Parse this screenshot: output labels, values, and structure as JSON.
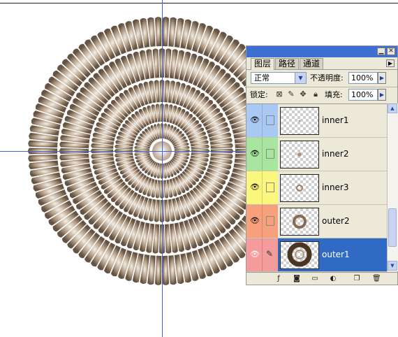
{
  "panel": {
    "tabs": [
      "图层",
      "路径",
      "通道"
    ],
    "blend_mode": "正常",
    "opacity_label": "不透明度:",
    "opacity_value": "100%",
    "lock_label": "锁定:",
    "fill_label": "填充:",
    "fill_value": "100%"
  },
  "layers": [
    {
      "name": "inner1",
      "color": "#a9c9f5",
      "selected": false
    },
    {
      "name": "inner2",
      "color": "#a8e6a0",
      "selected": false
    },
    {
      "name": "inner3",
      "color": "#fbf67d",
      "selected": false
    },
    {
      "name": "outer2",
      "color": "#f6a17c",
      "selected": false
    },
    {
      "name": "outer1",
      "color": "#f49c9c",
      "selected": true
    }
  ],
  "colors": {
    "titlebar": "#3d6fd1",
    "selection": "#316ac5",
    "guides": "#3b66d9",
    "shell_dark": "#4a3522",
    "shell_light": "#efe8dc"
  },
  "icons": [
    "eye-icon",
    "brush-icon",
    "lock-transparency-icon",
    "lock-image-icon",
    "lock-move-icon",
    "lock-all-icon",
    "layer-style-icon",
    "mask-icon",
    "folder-icon",
    "adjustment-icon",
    "new-layer-icon",
    "trash-icon"
  ]
}
